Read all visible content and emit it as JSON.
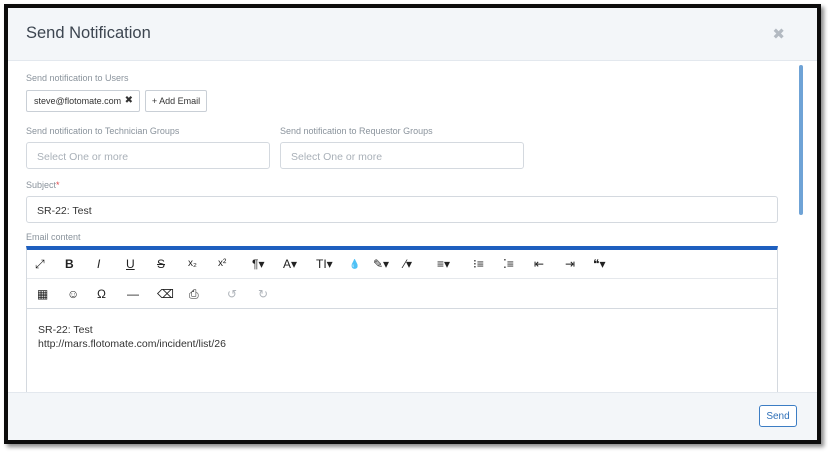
{
  "modal": {
    "title": "Send Notification",
    "close_icon": "close-icon"
  },
  "users": {
    "label": "Send notification to Users",
    "chips": [
      {
        "email": "steve@flotomate.com",
        "remove_glyph": "✖"
      }
    ],
    "add_label": "+ Add Email"
  },
  "tech_groups": {
    "label": "Send notification to Technician Groups",
    "placeholder": "Select One or more"
  },
  "req_groups": {
    "label": "Send notification to Requestor Groups",
    "placeholder": "Select One or more"
  },
  "subject": {
    "label": "Subject",
    "required_mark": "*",
    "value": "SR-22: Test"
  },
  "email_content": {
    "label": "Email content",
    "toolbar_row1": [
      {
        "name": "fullscreen-icon",
        "glyph": "⤢"
      },
      {
        "name": "bold-icon",
        "glyph": "B"
      },
      {
        "name": "italic-icon",
        "glyph": "I"
      },
      {
        "name": "underline-icon",
        "glyph": "U"
      },
      {
        "name": "strikethrough-icon",
        "glyph": "S"
      },
      {
        "name": "subscript-icon",
        "glyph": "x₂"
      },
      {
        "name": "superscript-icon",
        "glyph": "x²"
      },
      {
        "name": "paragraph-format-icon",
        "glyph": "¶▾"
      },
      {
        "name": "font-family-icon",
        "glyph": "A▾"
      },
      {
        "name": "font-size-icon",
        "glyph": "TI▾"
      },
      {
        "name": "text-color-icon",
        "glyph": "💧"
      },
      {
        "name": "background-color-icon",
        "glyph": "✎▾"
      },
      {
        "name": "inline-style-icon",
        "glyph": "⁄▾"
      },
      {
        "name": "align-icon",
        "glyph": "≡▾"
      },
      {
        "name": "ordered-list-icon",
        "glyph": "⁝≡"
      },
      {
        "name": "unordered-list-icon",
        "glyph": "⁚≡"
      },
      {
        "name": "outdent-icon",
        "glyph": "⇤"
      },
      {
        "name": "indent-icon",
        "glyph": "⇥"
      },
      {
        "name": "quote-icon",
        "glyph": "❝▾"
      }
    ],
    "toolbar_row2": [
      {
        "name": "table-icon",
        "glyph": "▦"
      },
      {
        "name": "emoticon-icon",
        "glyph": "☺"
      },
      {
        "name": "special-characters-icon",
        "glyph": "Ω"
      },
      {
        "name": "horizontal-line-icon",
        "glyph": "—"
      },
      {
        "name": "clear-formatting-icon",
        "glyph": "⌫"
      },
      {
        "name": "print-icon",
        "glyph": "⎙"
      },
      {
        "name": "undo-icon",
        "glyph": "↺",
        "disabled": true
      },
      {
        "name": "redo-icon",
        "glyph": "↻",
        "disabled": true
      }
    ],
    "body_lines": [
      "SR-22: Test",
      "http://mars.flotomate.com/incident/list/26"
    ]
  },
  "footer": {
    "send_label": "Send"
  }
}
